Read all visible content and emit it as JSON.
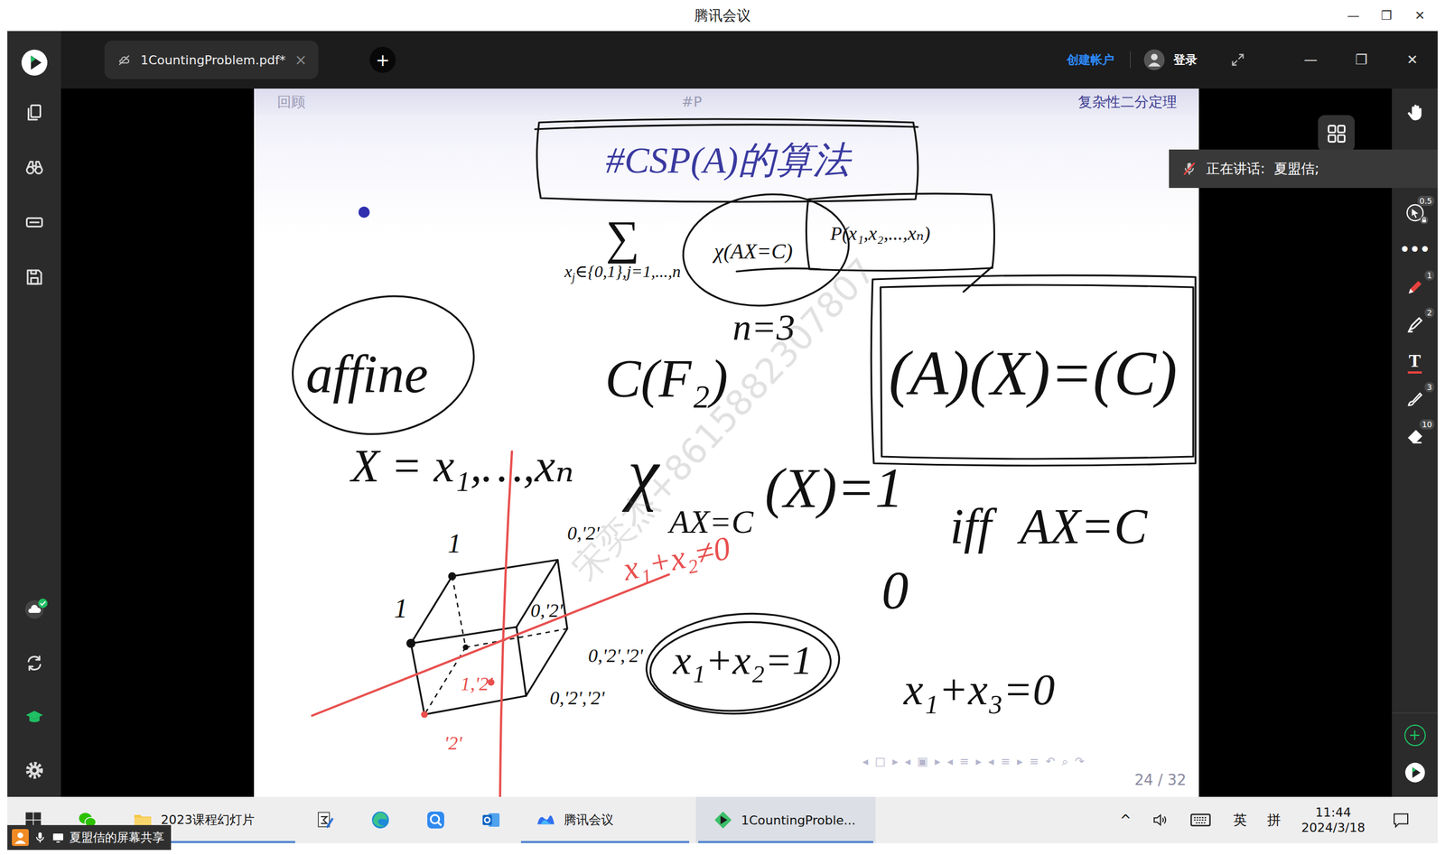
{
  "window": {
    "title": "腾讯会议",
    "controls": [
      "—",
      "❐",
      "✕"
    ]
  },
  "tabbar": {
    "tabs": [
      {
        "label": "1CountingProblem.pdf*",
        "close": "×",
        "selected": true
      }
    ],
    "add": "+",
    "create_account": "创建帐户",
    "login": "登录",
    "controls": [
      "—",
      "❐",
      "✕"
    ]
  },
  "sidebar": {
    "items": [
      {
        "kind": "logo"
      },
      {
        "kind": "docs"
      },
      {
        "kind": "binoculars"
      },
      {
        "kind": "keyboard"
      },
      {
        "kind": "save"
      },
      {
        "kind": "cloud",
        "synced": true
      },
      {
        "kind": "swirl"
      },
      {
        "kind": "cap"
      },
      {
        "kind": "gear"
      }
    ]
  },
  "speaking": {
    "label": "正在讲话:",
    "speaker": "夏盟佶;",
    "muted": true
  },
  "tools": {
    "top": [
      {
        "kind": "hand",
        "color": "#ffffff"
      },
      {
        "kind": "laser",
        "badge": "0.5",
        "locked": true,
        "color": "#ffffff"
      },
      {
        "kind": "more",
        "glyph": "•••",
        "color": "#ffffff"
      },
      {
        "kind": "pen",
        "badge": "1",
        "color": "#e8413e"
      },
      {
        "kind": "highlighter",
        "badge": "2",
        "color": "#ffffff"
      },
      {
        "kind": "text",
        "glyph": "T",
        "color": "#ffffff"
      },
      {
        "kind": "brush",
        "badge": "3",
        "color": "#ffffff"
      },
      {
        "kind": "eraser",
        "badge": "10",
        "color": "#ffffff"
      }
    ],
    "bottom": [
      {
        "kind": "add",
        "glyph": "+",
        "color": "#1fbf63"
      },
      {
        "kind": "logo",
        "color": "#1fbf63"
      }
    ]
  },
  "slide": {
    "header": {
      "left": "回顾",
      "center": "#P",
      "right": "复杂性二分定理"
    },
    "title": "#CSP(A)的算法",
    "formula": {
      "sum": "∑",
      "range": [
        "x",
        "j",
        "∈{0,1},j=1,...,n"
      ],
      "chi": "χ(AX=C)",
      "p": "P(x₁,x₂,...,xₙ)"
    },
    "nav": [
      "◂",
      "□",
      "▸",
      "◂",
      "▣",
      "▸",
      "◂",
      "≡",
      "▸",
      "◂",
      "≡",
      "▸",
      "≡",
      "↶",
      "⌕",
      "↷"
    ],
    "page": "24 / 32",
    "watermark": "宋奕杰+8615882307807"
  },
  "ink": {
    "notes": [
      {
        "text": "affine",
        "color": "#111111"
      },
      {
        "text": "X = x₁,…,xₙ",
        "color": "#111111"
      },
      {
        "text": "C(F₂)",
        "color": "#111111"
      },
      {
        "text": "n=3",
        "color": "#111111"
      },
      {
        "text": "(A)(X)=(C)",
        "color": "#111111"
      },
      {
        "text": "χ",
        "color": "#111111"
      },
      {
        "text": "AX=C",
        "color": "#111111"
      },
      {
        "text": "(X)=1",
        "color": "#111111"
      },
      {
        "text": "iff AX=C",
        "color": "#111111"
      },
      {
        "text": "0",
        "color": "#111111"
      },
      {
        "text": "x₁+x₂≠0",
        "color": "#e8504f"
      },
      {
        "text": "x₁+x₂=1",
        "color": "#111111"
      },
      {
        "text": "x₁+x₃=0",
        "color": "#111111"
      }
    ],
    "labels": [
      {
        "text": "0,'2'",
        "color": "#111111"
      },
      {
        "text": "0,'2'",
        "color": "#111111"
      },
      {
        "text": "0,'2','2'",
        "color": "#111111"
      },
      {
        "text": "0,'2','2'",
        "color": "#111111"
      },
      {
        "text": "1,'2'",
        "color": "#e8504f"
      },
      {
        "text": "'2'",
        "color": "#e8504f"
      },
      {
        "text": "1",
        "color": "#111111"
      },
      {
        "text": "1",
        "color": "#111111"
      }
    ]
  },
  "taskbar": {
    "apps": [
      {
        "kind": "start",
        "running": false,
        "selected": false
      },
      {
        "kind": "wechat",
        "running": false,
        "selected": false
      },
      {
        "kind": "folder",
        "label": "2023课程幻灯片",
        "running": true,
        "selected": false
      },
      {
        "kind": "editor",
        "running": false,
        "selected": false
      },
      {
        "kind": "edge",
        "running": false,
        "selected": false
      },
      {
        "kind": "search",
        "running": false,
        "selected": false
      },
      {
        "kind": "outlook",
        "running": false,
        "selected": false
      },
      {
        "kind": "meeting",
        "label": "腾讯会议",
        "running": true,
        "selected": false
      },
      {
        "kind": "pdf",
        "label": "1CountingProble...",
        "running": true,
        "selected": true
      }
    ],
    "tray": {
      "chevron": "^",
      "lang": "英",
      "ime": "拼",
      "time": "11:44",
      "date": "2024/3/18"
    }
  },
  "share_bar": {
    "label": "夏盟佶的屏幕共享"
  }
}
